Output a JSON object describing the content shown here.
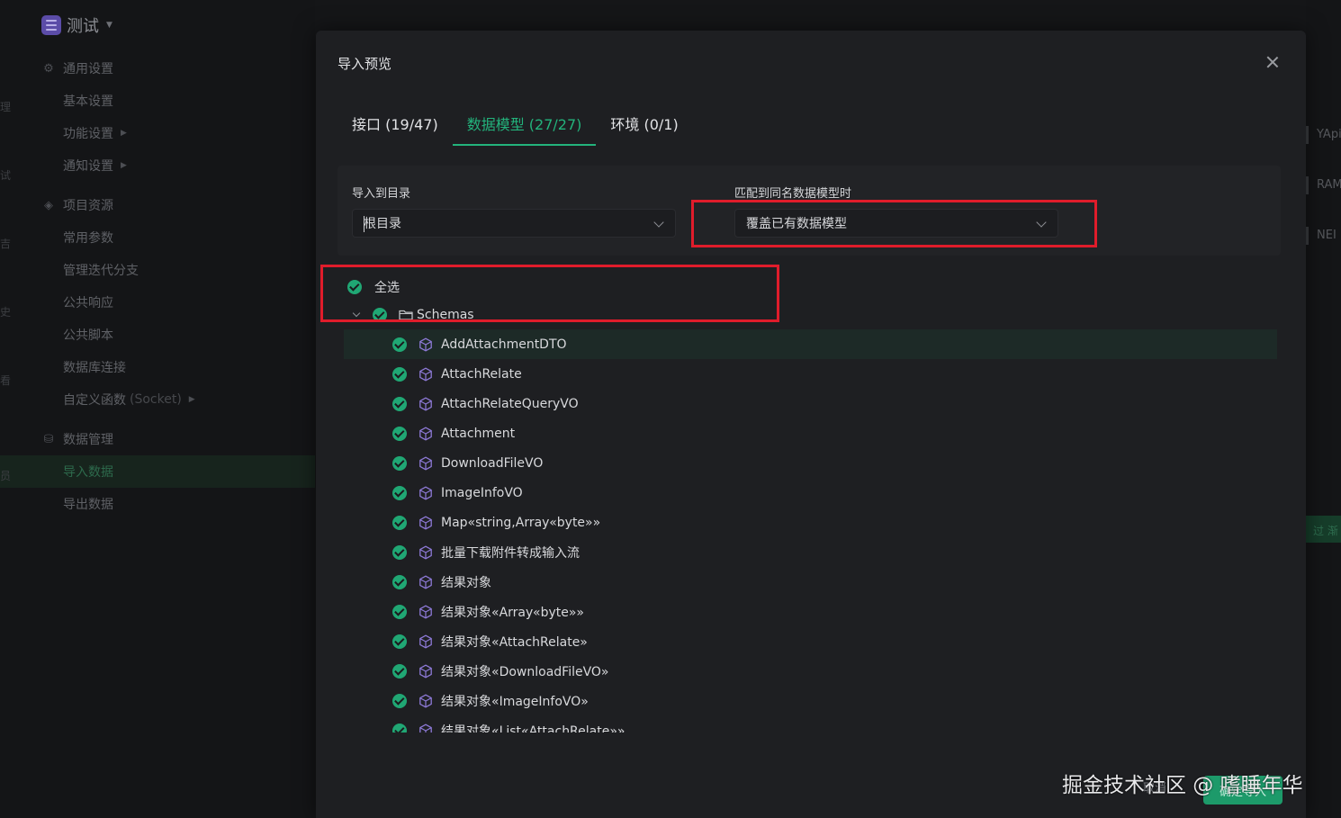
{
  "workspace": {
    "title": "测试"
  },
  "sidebar": {
    "groups": [
      {
        "label": "通用设置",
        "icon": "gear-icon",
        "items": [
          {
            "label": "基本设置",
            "chevron": false
          },
          {
            "label": "功能设置",
            "chevron": true
          },
          {
            "label": "通知设置",
            "chevron": true
          }
        ]
      },
      {
        "label": "项目资源",
        "icon": "layers-icon",
        "items": [
          {
            "label": "常用参数"
          },
          {
            "label": "管理迭代分支"
          },
          {
            "label": "公共响应"
          },
          {
            "label": "公共脚本"
          },
          {
            "label": "数据库连接"
          },
          {
            "label": "自定义函数",
            "suffix": "(Socket)",
            "chevron": true
          }
        ]
      },
      {
        "label": "数据管理",
        "icon": "database-icon",
        "items": [
          {
            "label": "导入数据",
            "active": true
          },
          {
            "label": "导出数据"
          }
        ]
      }
    ],
    "edge_glyphs": [
      "理",
      "试",
      "吉",
      "史",
      "看",
      "员"
    ]
  },
  "right_peek": {
    "items": [
      "YApi",
      "RAM",
      "NEI"
    ],
    "button": "过 渐"
  },
  "modal": {
    "title": "导入预览",
    "tabs": [
      {
        "label": "接口 (19/47)",
        "active": false
      },
      {
        "label": "数据模型 (27/27)",
        "active": true
      },
      {
        "label": "环境 (0/1)",
        "active": false
      }
    ],
    "import_dir": {
      "label": "导入到目录",
      "value": "根目录"
    },
    "on_conflict": {
      "label": "匹配到同名数据模型时",
      "value": "覆盖已有数据模型"
    },
    "select_all_label": "全选",
    "folder": {
      "label": "Schemas",
      "icon": "folder-icon"
    },
    "items": [
      "AddAttachmentDTO",
      "AttachRelate",
      "AttachRelateQueryVO",
      "Attachment",
      "DownloadFileVO",
      "ImageInfoVO",
      "Map«string,Array«byte»»",
      "批量下载附件转成输入流",
      "结果对象",
      "结果对象«Array«byte»»",
      "结果对象«AttachRelate»",
      "结果对象«DownloadFileVO»",
      "结果对象«ImageInfoVO»",
      "结果对象«List«AttachRelate»»"
    ],
    "footer": {
      "cancel": "取消",
      "confirm": "确定导入"
    }
  },
  "watermark": "掘金技术社区 @ 嗜睡年华",
  "colors": {
    "accent": "#23b37c",
    "checkbox": "#20a774",
    "highlight": "#e01c2b",
    "modal_bg": "#1e1f22"
  }
}
